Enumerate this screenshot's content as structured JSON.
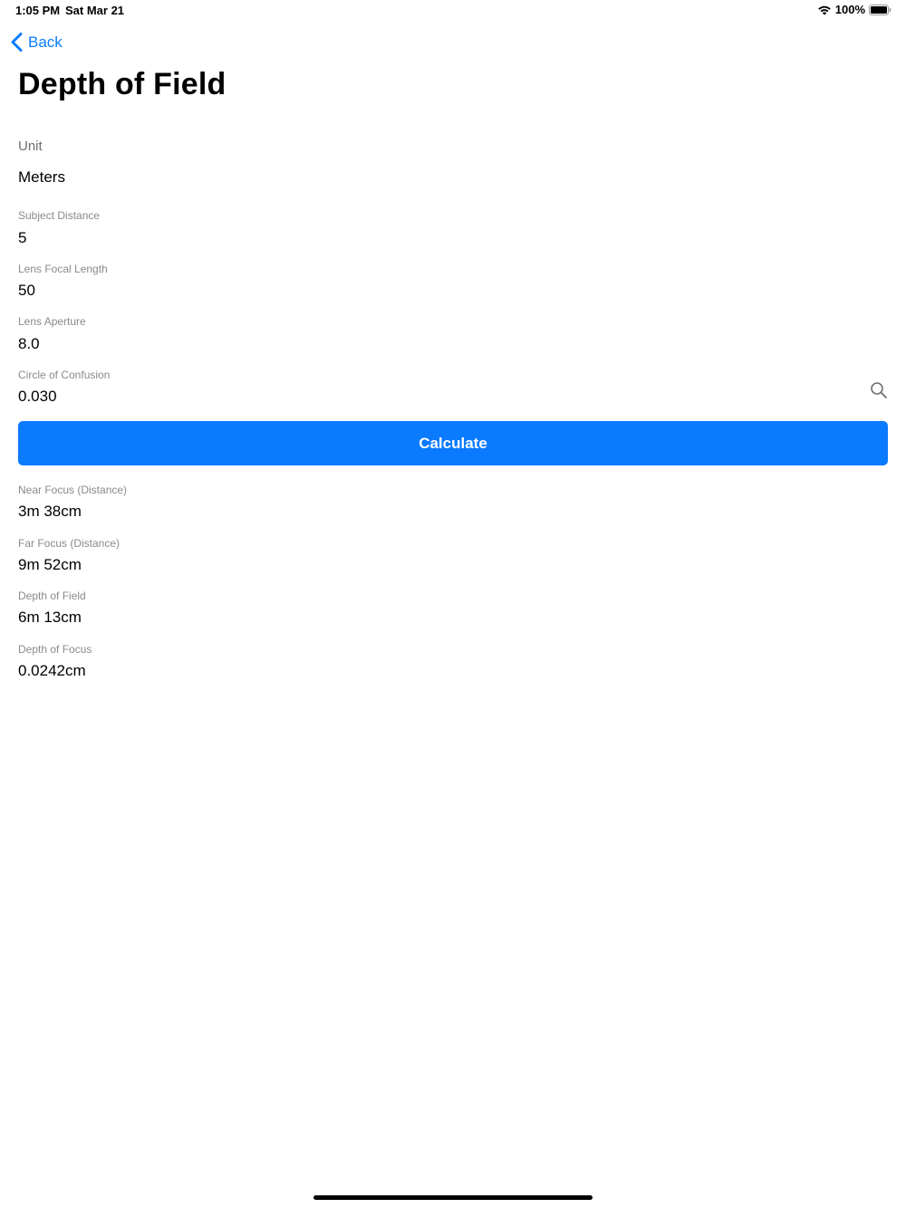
{
  "status_bar": {
    "time": "1:05 PM",
    "date": "Sat Mar 21",
    "battery_text": "100%",
    "icons": [
      "wifi-icon",
      "battery-icon"
    ]
  },
  "nav": {
    "back_label": "Back",
    "title": "Depth of Field"
  },
  "unit": {
    "label": "Unit",
    "value": "Meters"
  },
  "inputs": {
    "subject_distance": {
      "label": "Subject Distance",
      "value": "5"
    },
    "focal_length": {
      "label": "Lens Focal Length",
      "value": "50"
    },
    "aperture": {
      "label": "Lens Aperture",
      "value": "8.0"
    },
    "coc": {
      "label": "Circle of Confusion",
      "value": "0.030",
      "icon": "search-icon"
    }
  },
  "calculate_label": "Calculate",
  "results": {
    "near_focus": {
      "label": "Near Focus (Distance)",
      "value": "3m 38cm"
    },
    "far_focus": {
      "label": "Far Focus (Distance)",
      "value": "9m 52cm"
    },
    "depth_of_field": {
      "label": "Depth of Field",
      "value": "6m 13cm"
    },
    "depth_of_focus": {
      "label": "Depth of Focus",
      "value": "0.0242cm"
    }
  },
  "colors": {
    "accent": "#0a7aff",
    "secondary_text": "#8a8a8e"
  }
}
